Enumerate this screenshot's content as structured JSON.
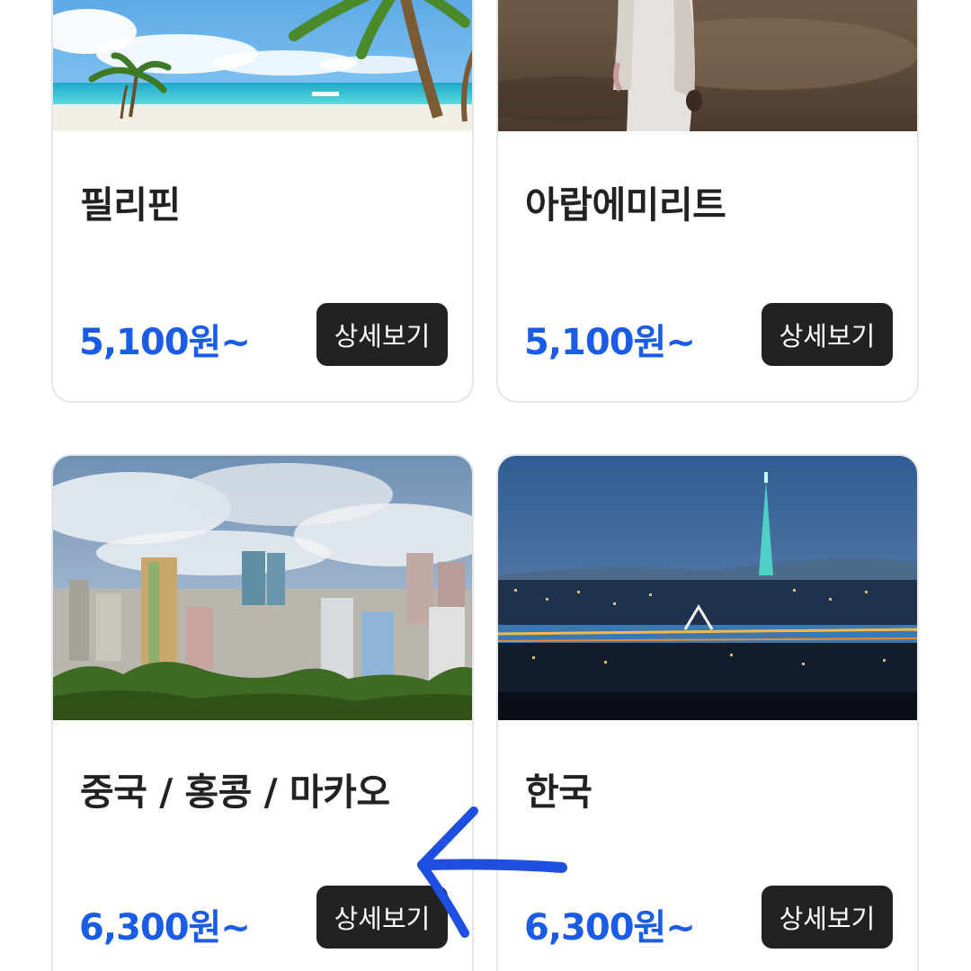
{
  "cards": [
    {
      "name": "필리핀",
      "price": "5,100원~",
      "button": "상세보기",
      "image": "beach-palm-photo"
    },
    {
      "name": "아랍에미리트",
      "price": "5,100원~",
      "button": "상세보기",
      "image": "desert-person-photo"
    },
    {
      "name": "중국 / 홍콩 / 마카오",
      "price": "6,300원~",
      "button": "상세보기",
      "image": "macau-skyline-photo"
    },
    {
      "name": "한국",
      "price": "6,300원~",
      "button": "상세보기",
      "image": "seoul-night-photo"
    }
  ],
  "colors": {
    "price": "#1a5ce6",
    "button_bg": "#222222",
    "button_text": "#ffffff",
    "card_border": "#e6e6e6",
    "annotation_arrow": "#1f4fe0"
  },
  "annotation": {
    "icon": "hand-drawn-left-arrow-icon"
  }
}
